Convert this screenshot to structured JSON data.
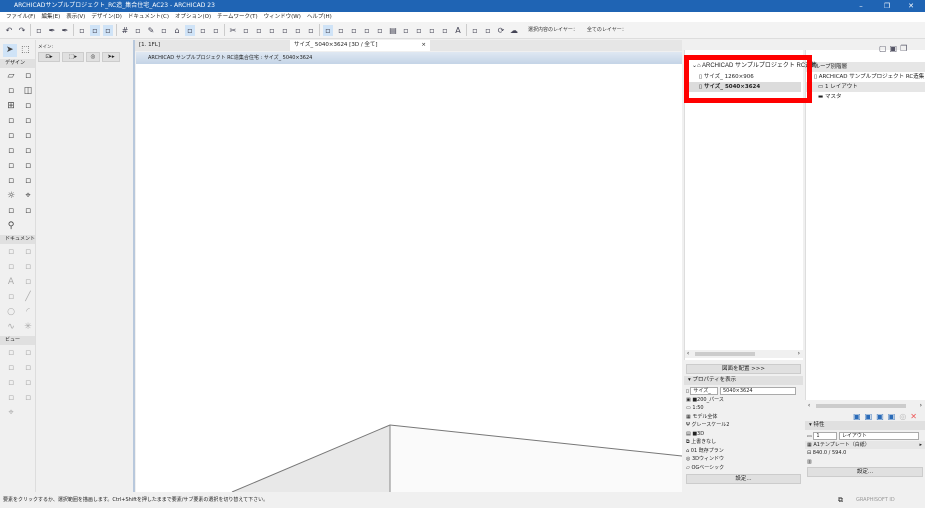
{
  "window": {
    "title": "ARCHICADサンプルプロジェクト_RC造_集合住宅_AC23 - ARCHICAD 23",
    "minimize": "–",
    "maximize": "❐",
    "close": "✕"
  },
  "menu": [
    "ファイル(F)",
    "編集(E)",
    "表示(V)",
    "デザイン(D)",
    "ドキュメント(C)",
    "オプション(O)",
    "チームワーク(T)",
    "ウィンドウ(W)",
    "ヘルプ(H)"
  ],
  "toolbar": {
    "icons": [
      "undo-icon",
      "redo-icon",
      "pick-icon",
      "eyedropper-icon",
      "inject-icon",
      "snap-guide-icon",
      "grid-snap-icon",
      "story-icon",
      "grid-icon",
      "surface-icon",
      "pencil-icon",
      "box-icon",
      "lock-icon",
      "layer-icon",
      "trace-icon",
      "dimension-icon",
      "scissors-icon",
      "magic-icon",
      "trim-icon",
      "fillet-icon",
      "offset-icon",
      "split-icon",
      "explode-icon",
      "selection-icon",
      "magic-wand-icon",
      "merge-icon",
      "rotate-icon",
      "section-icon",
      "table-icon",
      "fixture-icon",
      "stair-icon",
      "label-icon",
      "elevation-icon",
      "text-icon",
      "marker-icon",
      "schedule-icon",
      "refresh-icon",
      "cloud-icon"
    ],
    "layer_selected_label": "選択内容のレイヤー：",
    "layer_all_label": "全てのレイヤー："
  },
  "toolbox": {
    "select_label": "デザイン",
    "info_label": "メイン:",
    "sections": [
      {
        "label": "デザイン",
        "icons": [
          "wall-icon",
          "curtain-wall-icon",
          "column-icon",
          "door-icon",
          "window-icon",
          "skylight-icon",
          "beam-icon",
          "slab-icon",
          "roof-icon",
          "shell-icon",
          "mesh-icon",
          "morph-icon",
          "object-icon",
          "zone-icon",
          "railing-icon",
          "stair-icon",
          "lamp-icon",
          "camera-icon",
          "roof-accessory-icon",
          "window-frame-icon",
          "pin-icon"
        ]
      },
      {
        "label": "ドキュメント",
        "icons": [
          "dimension-icon",
          "level-icon",
          "radial-icon",
          "angle-icon",
          "text-icon",
          "label-icon",
          "fill-icon",
          "line-icon",
          "circle-icon",
          "arc-icon",
          "spline-icon",
          "hotspot-icon"
        ]
      },
      {
        "label": "ビュー",
        "icons": [
          "figure-icon",
          "drawing-icon",
          "section-icon",
          "elevation-icon",
          "interior-icon",
          "worksheet-icon",
          "detail-icon",
          "change-icon",
          "camera-icon"
        ]
      }
    ]
  },
  "tabs": {
    "floor": "[1. 1FL]",
    "active": "サイズ_ 5040×3624 [3D / 全て]",
    "close": "×"
  },
  "viewport": {
    "header": "ARCHICAD サンプルプロジェクト RC造集合住宅 : サイズ_ 5040×3624"
  },
  "status": "要素をクリックするか、選択範囲を描画します。Ctrl+Shiftを押したままで要素/サブ要素の選択を切り替えて下さい。",
  "navigator": {
    "root": "ARCHICAD サンプルプロジェクト RC造集",
    "items": [
      "サイズ_ 1260×906",
      "サイズ_ 5040×3624"
    ],
    "place_button": "図面を配置 >>>",
    "props_header": "プロパティを表示",
    "props": {
      "id": "サイズ_",
      "name": "5040×3624",
      "rows": [
        "■200_パース",
        "1:50",
        "モデル全体",
        "グレースケール2",
        "■3D",
        "上書きなし",
        "01 既存プラン",
        "3Dウィンドウ",
        "OGベーシック"
      ]
    },
    "settings": "設定..."
  },
  "organizer": {
    "header": "グループ別階層",
    "root": "ARCHICAD サンプルプロジェクト RC造集",
    "items": [
      "1 レイアウト",
      "マスタ"
    ],
    "attr_header": "特性",
    "id": "1",
    "name": "レイアウト",
    "template": "A1テンプレート（白紙）",
    "size": "840.0 / 594.0",
    "settings": "設定...",
    "brand": "GRAPHISOFT ID"
  }
}
